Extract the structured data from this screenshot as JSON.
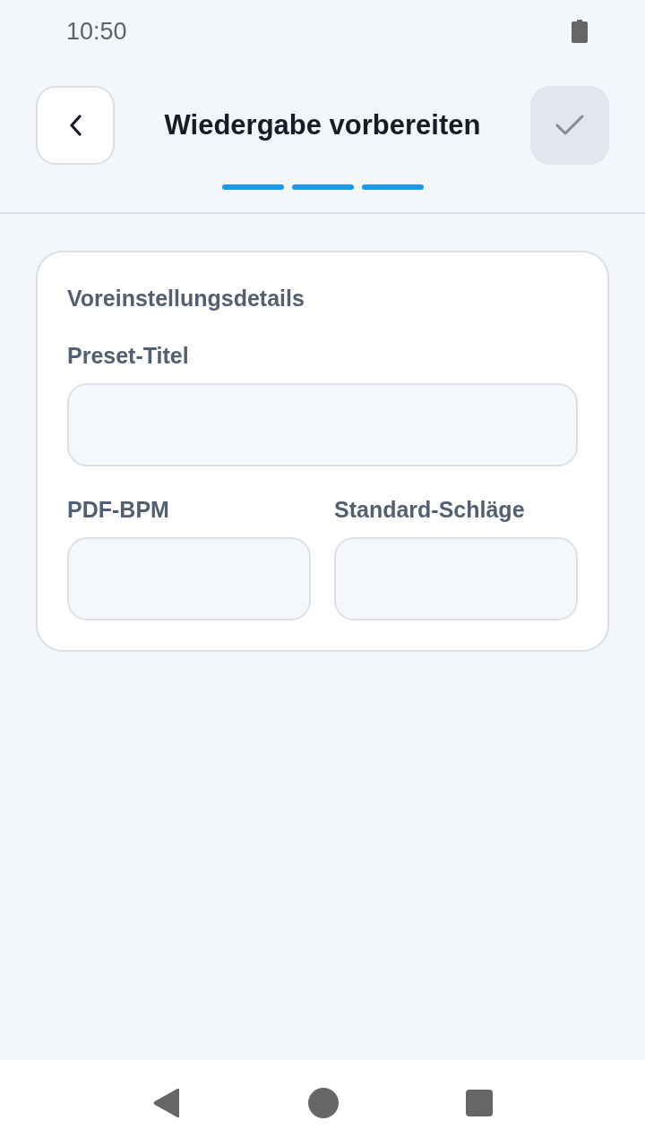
{
  "status_bar": {
    "time": "10:50"
  },
  "header": {
    "title": "Wiedergabe vorbereiten",
    "back_button": {
      "disabled": false
    },
    "confirm_button": {
      "disabled": true
    }
  },
  "steps": [
    {
      "done": true
    },
    {
      "done": true
    },
    {
      "done": true
    }
  ],
  "card": {
    "title": "Voreinstellungsdetails",
    "fields": [
      {
        "label": "Preset-Titel",
        "full_width": true
      },
      {
        "label": "PDF-BPM",
        "full_width": false
      },
      {
        "label": "Standard-Schläge",
        "full_width": false
      }
    ]
  },
  "nav_bar": {
    "buttons": [
      {
        "kind": "back"
      },
      {
        "kind": "home"
      },
      {
        "kind": "recents"
      }
    ]
  }
}
